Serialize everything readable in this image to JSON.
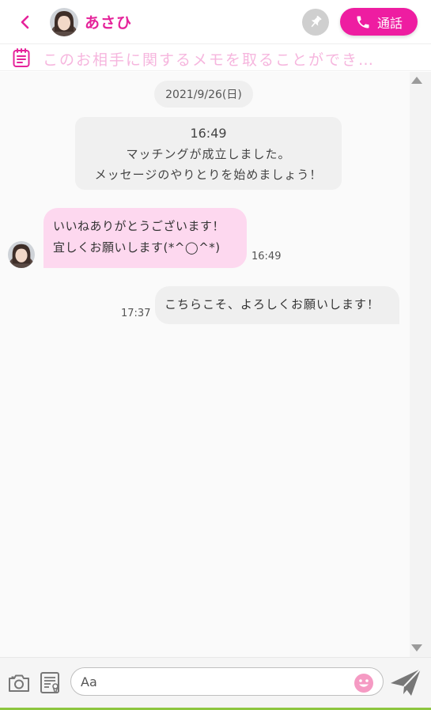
{
  "header": {
    "name": "あさひ",
    "call_label": "通話"
  },
  "memo": {
    "text": "このお相手に関するメモを取ることができ…"
  },
  "chat": {
    "date": "2021/9/26(日)",
    "system": {
      "time": "16:49",
      "line1": "マッチングが成立しました。",
      "line2": "メッセージのやりとりを始めましょう！"
    },
    "messages": [
      {
        "line1": "いいねありがとうございます！",
        "line2": "宜しくお願いします(*^◯^*)",
        "time": "16:49"
      },
      {
        "text": "こちらこそ、よろしくお願いします！",
        "time": "17:37"
      }
    ]
  },
  "input": {
    "placeholder": "Aa"
  },
  "colors": {
    "accent": "#ee1da1",
    "name": "#e5239a",
    "bubble_in": "#fdd8ef",
    "memo_text": "#f6b6de"
  }
}
